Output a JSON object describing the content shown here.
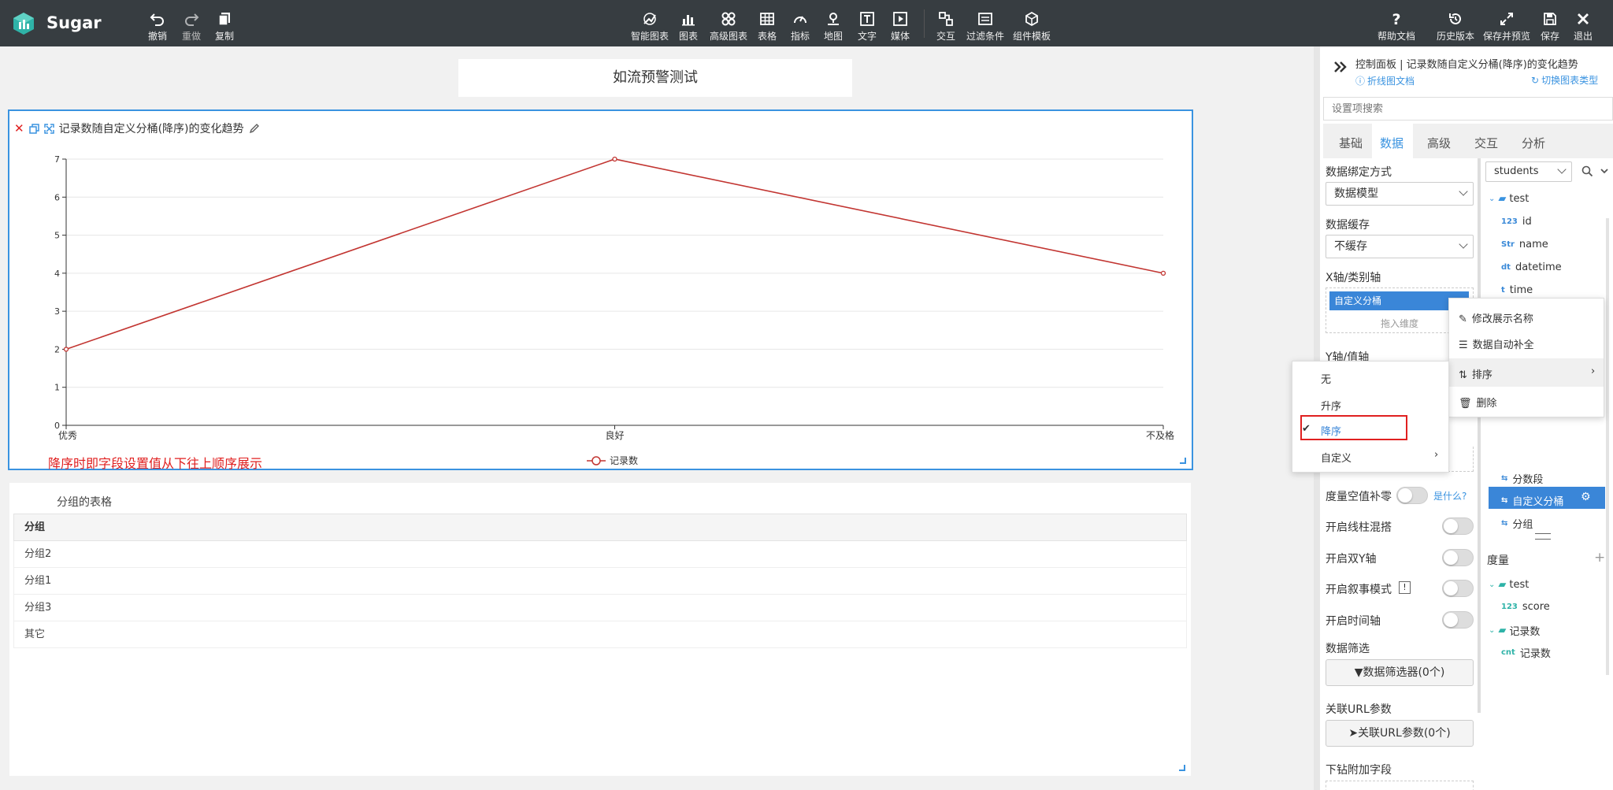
{
  "app": {
    "name": "Sugar"
  },
  "toolbar": {
    "left": [
      {
        "label": "撤销",
        "icon": "undo-icon"
      },
      {
        "label": "重做",
        "icon": "redo-icon"
      },
      {
        "label": "复制",
        "icon": "copy-icon"
      }
    ],
    "center": [
      {
        "label": "智能图表"
      },
      {
        "label": "图表"
      },
      {
        "label": "高级图表"
      },
      {
        "label": "表格"
      },
      {
        "label": "指标"
      },
      {
        "label": "地图"
      },
      {
        "label": "文字"
      },
      {
        "label": "媒体"
      },
      {
        "label": "交互"
      },
      {
        "label": "过滤条件"
      },
      {
        "label": "组件模板"
      }
    ],
    "right": [
      {
        "label": "帮助文档"
      },
      {
        "label": "历史版本"
      },
      {
        "label": "保存并预览"
      },
      {
        "label": "保存"
      },
      {
        "label": "退出"
      }
    ]
  },
  "dashboard": {
    "title": "如流预警测试"
  },
  "chart_widget": {
    "title": "记录数随自定义分桶(降序)的变化趋势",
    "annotation": "降序时即字段设置值从下往上顺序展示"
  },
  "chart_data": {
    "type": "line",
    "categories": [
      "优秀",
      "良好",
      "不及格"
    ],
    "series": [
      {
        "name": "记录数",
        "values": [
          2,
          7,
          4
        ],
        "color": "#c23531"
      }
    ],
    "y_ticks": [
      "0",
      "1",
      "2",
      "3",
      "4",
      "5",
      "6",
      "7"
    ],
    "ylim": [
      0,
      7
    ],
    "grid": true,
    "legend_position": "bottom-center"
  },
  "table_widget": {
    "title": "分组的表格",
    "header": "分组",
    "rows": [
      "分组2",
      "分组1",
      "分组3",
      "其它"
    ]
  },
  "panel": {
    "breadcrumb": "控制面板 | 记录数随自定义分桶(降序)的变化趋势",
    "doc_link": "折线图文档",
    "switch_type": "切换图表类型",
    "search_placeholder": "设置项搜索",
    "tabs": [
      "基础",
      "数据",
      "高级",
      "交互",
      "分析"
    ],
    "active_tab": "数据",
    "bind_label": "数据绑定方式",
    "bind_value": "数据模型",
    "cache_label": "数据缓存",
    "cache_value": "不缓存",
    "x_axis_label": "X轴/类别轴",
    "x_axis_chip": "自定义分桶",
    "drag_dim": "拖入维度",
    "y_axis_label": "Y轴/值轴",
    "zero_fill_label": "度量空值补零",
    "what_is": "是什么?",
    "mix_label": "开启线柱混搭",
    "dual_y_label": "开启双Y轴",
    "narrative_label": "开启叙事模式",
    "narrative_badge": "!",
    "time_axis_label": "开启时间轴",
    "filter_label": "数据筛选",
    "filter_btn": "数据筛选器(0个)",
    "url_label": "关联URL参数",
    "url_btn": "关联URL参数(0个)",
    "drill_label": "下钻附加字段"
  },
  "fields": {
    "dataset": "students",
    "dims_folder": "test",
    "dims": [
      {
        "type": "123",
        "name": "id"
      },
      {
        "type": "Str",
        "name": "name"
      },
      {
        "type": "dt",
        "name": "datetime"
      },
      {
        "type": "t",
        "name": "time"
      }
    ],
    "extra_dims": [
      "分数段",
      "自定义分桶",
      "分组"
    ],
    "measure_label": "度量",
    "measure_folders": [
      {
        "name": "test",
        "items": [
          {
            "type": "123",
            "name": "score"
          }
        ]
      },
      {
        "name": "记录数",
        "items": [
          {
            "type": "cnt",
            "name": "记录数"
          }
        ]
      }
    ]
  },
  "context_menu": {
    "items": [
      "修改展示名称",
      "数据自动补全",
      "排序",
      "删除"
    ]
  },
  "sort_menu": {
    "items": [
      "无",
      "升序",
      "降序",
      "自定义"
    ],
    "checked": "降序"
  }
}
